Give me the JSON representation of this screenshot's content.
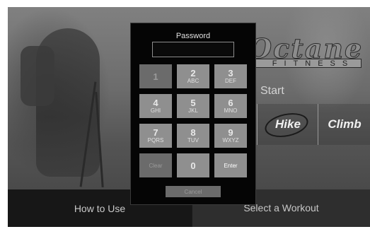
{
  "brand": {
    "word": "Octane",
    "sub": "FITNESS"
  },
  "start": {
    "label": "Start"
  },
  "workouts": [
    {
      "label": "Hike"
    },
    {
      "label": "Climb"
    }
  ],
  "bottom": {
    "how_to": "How to Use",
    "select_workout": "Select a Workout"
  },
  "dialog": {
    "title": "Password",
    "password_value": "",
    "keys": [
      {
        "num": "1",
        "letters": ""
      },
      {
        "num": "2",
        "letters": "ABC"
      },
      {
        "num": "3",
        "letters": "DEF"
      },
      {
        "num": "4",
        "letters": "GHI"
      },
      {
        "num": "5",
        "letters": "JKL"
      },
      {
        "num": "6",
        "letters": "MNO"
      },
      {
        "num": "7",
        "letters": "PQRS"
      },
      {
        "num": "8",
        "letters": "TUV"
      },
      {
        "num": "9",
        "letters": "WXYZ"
      },
      {
        "num": "Clear",
        "letters": ""
      },
      {
        "num": "0",
        "letters": ""
      },
      {
        "num": "Enter",
        "letters": ""
      }
    ],
    "cancel": "Cancel"
  },
  "colors": {
    "keypad_key": "#8f8f8f",
    "keypad_key_disabled": "#6b6b6b",
    "dialog_bg": "#050505",
    "bottom_bar": "#171717"
  }
}
